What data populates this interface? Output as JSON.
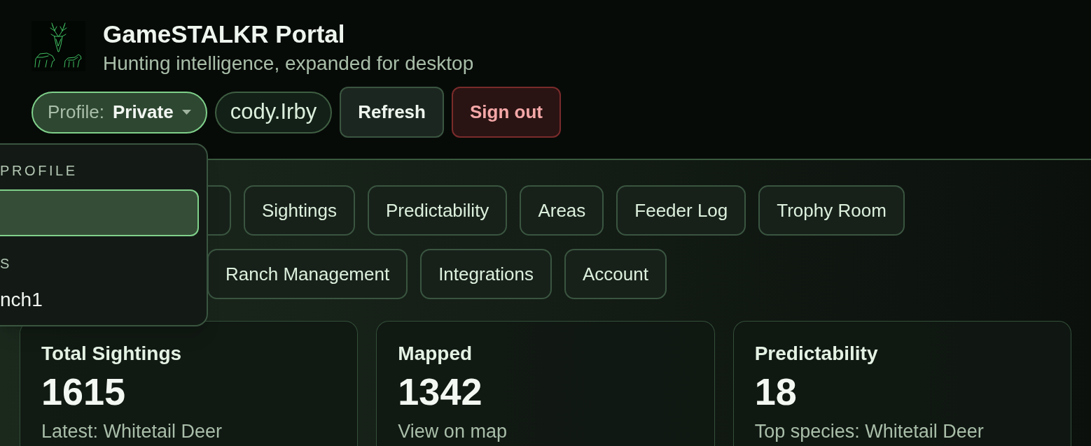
{
  "header": {
    "title": "GameSTALKR Portal",
    "subtitle": "Hunting intelligence, expanded for desktop",
    "profile_selector": {
      "label": "Profile:",
      "value": "Private",
      "expanded": true
    },
    "username": "cody.Irby",
    "buttons": [
      {
        "label": "Refresh",
        "kind": "default"
      },
      {
        "label": "Sign out",
        "kind": "danger"
      }
    ]
  },
  "profile_menu": {
    "sections": [
      {
        "heading": "PROFILE",
        "items": [
          {
            "selected": true
          }
        ]
      },
      {
        "heading": "S",
        "items": [
          {
            "label": "nch1",
            "selected": false
          }
        ]
      }
    ]
  },
  "nav": {
    "rows": [
      {
        "tabs": [
          {
            "selected": false
          },
          {
            "label": "Sightings",
            "selected": false
          },
          {
            "label": "Predictability",
            "selected": false
          },
          {
            "label": "Areas",
            "selected": false
          },
          {
            "label": "Feeder Log",
            "selected": false
          },
          {
            "label": "Trophy Room",
            "selected": false
          }
        ]
      },
      {
        "tabs": [
          {
            "label": "Ranch Management",
            "selected": false
          },
          {
            "label": "Integrations",
            "selected": false
          },
          {
            "label": "Account",
            "selected": false
          }
        ]
      }
    ]
  },
  "stats": [
    {
      "title": "Total Sightings",
      "value": "1615",
      "note": "Latest: Whitetail Deer"
    },
    {
      "title": "Mapped",
      "value": "1342",
      "note": "View on map"
    },
    {
      "title": "Predictability",
      "value": "18",
      "note": "Top species: Whitetail Deer"
    }
  ]
}
